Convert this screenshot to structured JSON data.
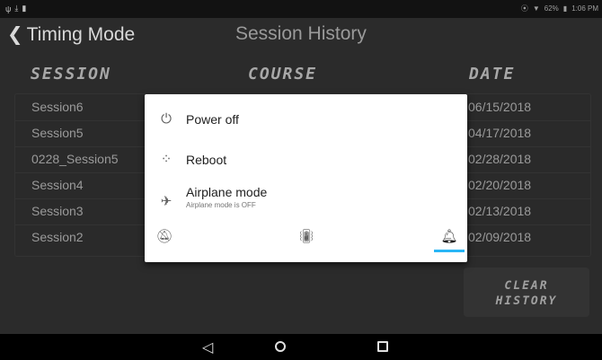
{
  "statusbar": {
    "battery_text": "62%",
    "time": "1:06 PM"
  },
  "header": {
    "back_label": "Timing Mode",
    "title": "Session History"
  },
  "columns": {
    "session": "SESSION",
    "course": "COURSE",
    "date": "DATE"
  },
  "rows": [
    {
      "session": "Session6",
      "date": "06/15/2018"
    },
    {
      "session": "Session5",
      "date": "04/17/2018"
    },
    {
      "session": "0228_Session5",
      "date": "02/28/2018"
    },
    {
      "session": "Session4",
      "date": "02/20/2018"
    },
    {
      "session": "Session3",
      "date": "02/13/2018"
    },
    {
      "session": "Session2",
      "date": "02/09/2018"
    }
  ],
  "clear_button": {
    "line1": "CLEAR",
    "line2": "HISTORY"
  },
  "power_menu": {
    "power_off": "Power off",
    "reboot": "Reboot",
    "airplane": "Airplane mode",
    "airplane_sub": "Airplane mode is OFF"
  },
  "colors": {
    "accent": "#29b6f6",
    "background": "#2b2b2b",
    "dialog": "#ffffff"
  },
  "icons": {
    "power": "power-icon",
    "reboot": "reboot-icon",
    "airplane": "airplane-icon",
    "silent": "bell-off-icon",
    "vibrate": "vibrate-icon",
    "sound": "bell-icon"
  }
}
